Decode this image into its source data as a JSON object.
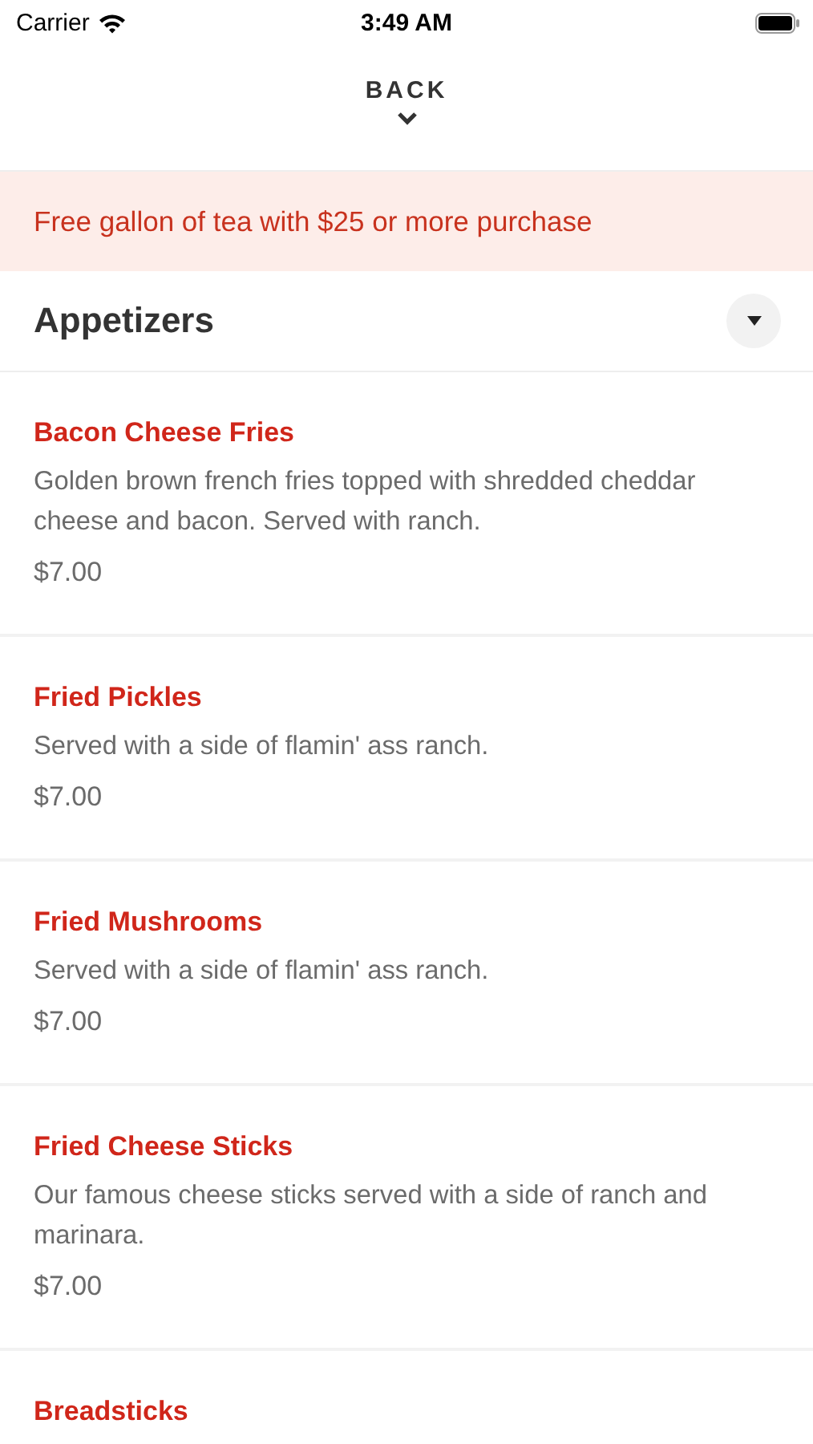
{
  "status_bar": {
    "carrier": "Carrier",
    "time": "3:49 AM"
  },
  "back": {
    "label": "BACK"
  },
  "promo": {
    "text": "Free gallon of tea with $25 or more purchase"
  },
  "section": {
    "title": "Appetizers"
  },
  "items": [
    {
      "name": "Bacon Cheese Fries",
      "description": "Golden brown french fries topped with shredded cheddar cheese and bacon. Served with ranch.",
      "price": "$7.00"
    },
    {
      "name": "Fried Pickles",
      "description": "Served with a side of flamin' ass ranch.",
      "price": "$7.00"
    },
    {
      "name": "Fried Mushrooms",
      "description": "Served with a side of flamin' ass ranch.",
      "price": "$7.00"
    },
    {
      "name": "Fried Cheese Sticks",
      "description": "Our famous cheese sticks served with a side of ranch and marinara.",
      "price": "$7.00"
    },
    {
      "name": "Breadsticks"
    }
  ]
}
